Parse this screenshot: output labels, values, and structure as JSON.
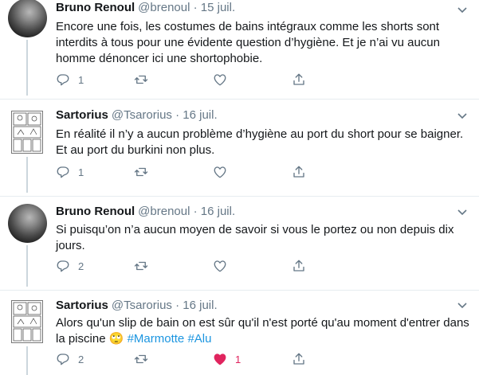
{
  "tweets": [
    {
      "name": "Bruno Renoul",
      "handle": "@brenoul",
      "date": "15 juil.",
      "text": "Encore une fois, les costumes de bains intégraux comme les shorts sont interdits à tous pour une évidente question d’hygiène. Et je n’ai vu aucun homme dénoncer ici une shortophobie.",
      "reply_count": "1",
      "like_count": ""
    },
    {
      "name": "Sartorius",
      "handle": "@Tsarorius",
      "date": "16 juil.",
      "text": "En réalité il n’y a aucun problème d’hygiène au port du short pour se baigner. Et au port du burkini non plus.",
      "reply_count": "1",
      "like_count": ""
    },
    {
      "name": "Bruno Renoul",
      "handle": "@brenoul",
      "date": "16 juil.",
      "text": "Si puisqu’on n’a aucun moyen de savoir si vous le portez ou non depuis dix jours.",
      "reply_count": "2",
      "like_count": ""
    },
    {
      "name": "Sartorius",
      "handle": "@Tsarorius",
      "date": "16 juil.",
      "text": "Alors qu'un slip de bain on est sûr qu'il n'est porté qu'au moment d'entrer dans la piscine",
      "emoji": "🙄",
      "hashtags": [
        "#Marmotte",
        "#Alu"
      ],
      "reply_count": "2",
      "like_count": "1",
      "liked": true
    }
  ],
  "separator": "·",
  "icons": [
    "reply-icon",
    "retweet-icon",
    "like-icon",
    "share-icon",
    "caret-down-icon"
  ],
  "colors": {
    "text": "#14171a",
    "secondary": "#657786",
    "link": "#1b95e0",
    "like": "#e0245e",
    "divider": "#e6ecf0"
  }
}
